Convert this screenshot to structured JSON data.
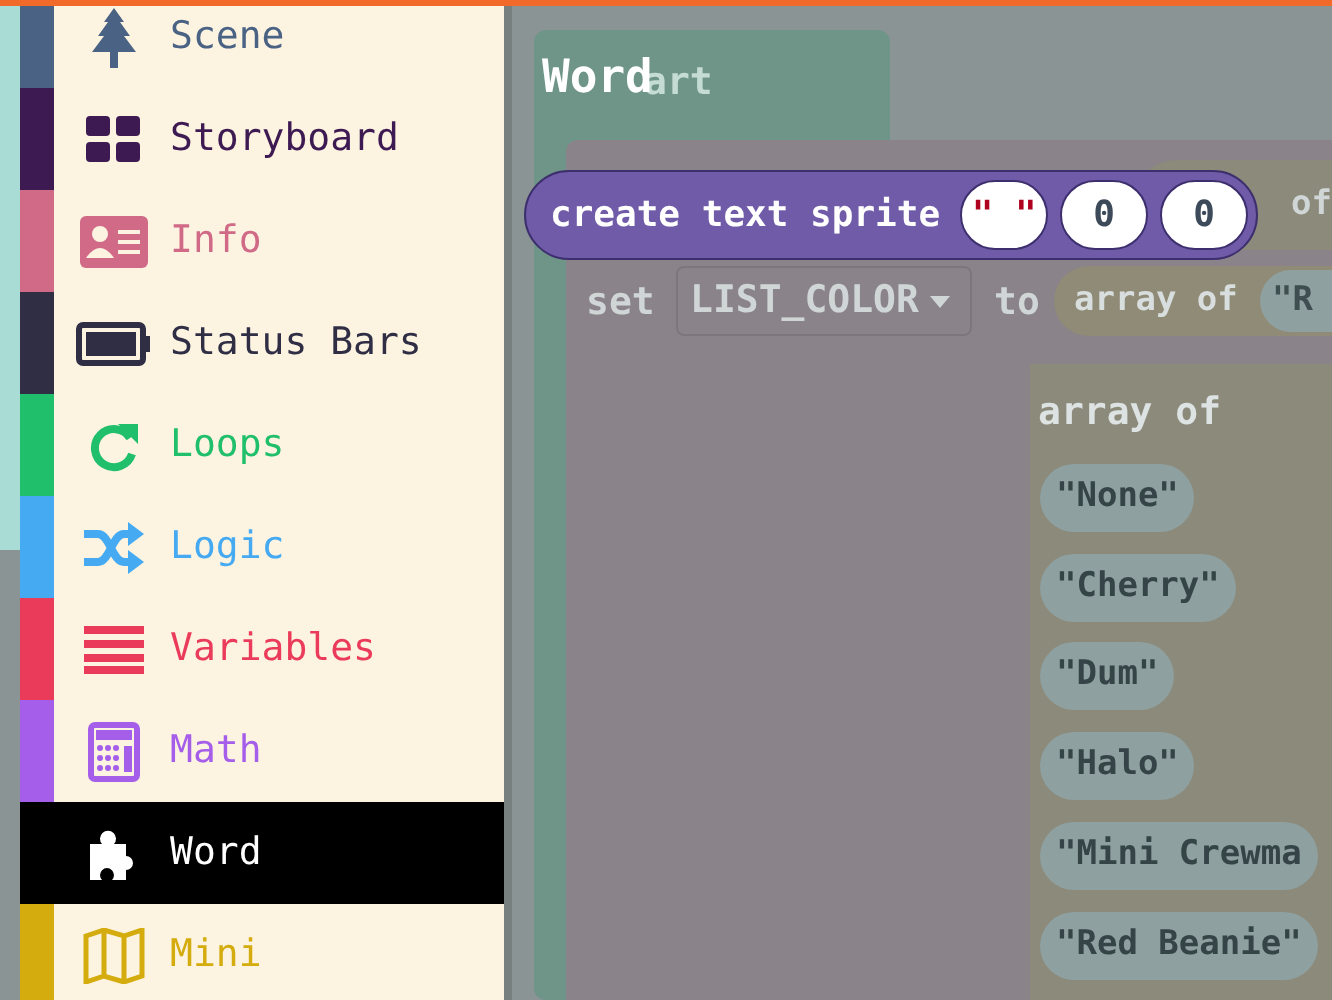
{
  "sidebar": {
    "items": [
      {
        "label": "Scene",
        "color": "#4a6283",
        "selected": false
      },
      {
        "label": "Storyboard",
        "color": "#3d1a52",
        "selected": false
      },
      {
        "label": "Info",
        "color": "#d06a87",
        "selected": false
      },
      {
        "label": "Status Bars",
        "color": "#2f2e45",
        "selected": false
      },
      {
        "label": "Loops",
        "color": "#20bf6b",
        "selected": false
      },
      {
        "label": "Logic",
        "color": "#45aaf2",
        "selected": false
      },
      {
        "label": "Variables",
        "color": "#eb3b5a",
        "selected": false
      },
      {
        "label": "Math",
        "color": "#a55eea",
        "selected": false
      },
      {
        "label": "Word",
        "color": "#000000",
        "selected": true
      },
      {
        "label": "Mini",
        "color": "#d4ac0d",
        "selected": false
      }
    ]
  },
  "flyout": {
    "title": "Word",
    "blocks": [
      {
        "label": "create text sprite",
        "inputs": [
          "\" \"",
          "0",
          "0"
        ]
      }
    ]
  },
  "workspace": {
    "start_block": {
      "label": "art"
    },
    "behind_block": {
      "label": "of"
    },
    "set_block": {
      "keyword": "set",
      "variable": "LIST_COLOR",
      "to": "to",
      "array_label": "array of",
      "first_item": "\"R"
    },
    "array_block": {
      "label": "array of",
      "items": [
        "\"None\"",
        "\"Cherry\"",
        "\"Dum\"",
        "\"Halo\"",
        "\"Mini Crewma",
        "\"Red Beanie\""
      ]
    }
  }
}
